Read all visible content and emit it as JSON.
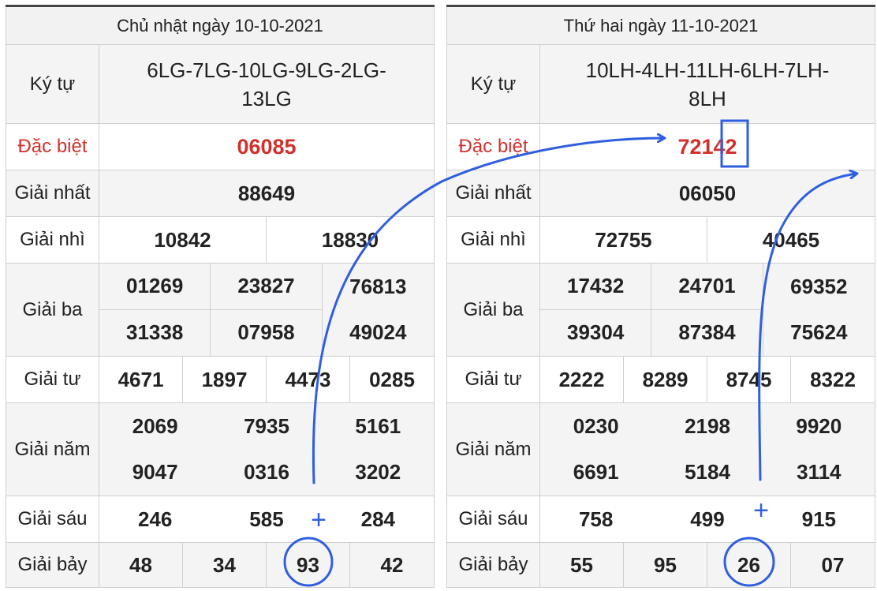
{
  "left": {
    "title": "Chủ nhật ngày 10-10-2021",
    "kytu_label": "Ký tự",
    "kytu_line1": "6LG-7LG-10LG-9LG-2LG-",
    "kytu_line2": "13LG",
    "db_label": "Đặc biệt",
    "db": "06085",
    "nhat_label": "Giải nhất",
    "nhat": "88649",
    "nhi_label": "Giải nhì",
    "nhi": [
      "10842",
      "18830"
    ],
    "ba_label": "Giải ba",
    "ba": [
      "01269",
      "23827",
      "76813",
      "31338",
      "07958",
      "49024"
    ],
    "tu_label": "Giải tư",
    "tu": [
      "4671",
      "1897",
      "4473",
      "0285"
    ],
    "nam_label": "Giải năm",
    "nam": [
      "2069",
      "7935",
      "5161",
      "9047",
      "0316",
      "3202"
    ],
    "sau_label": "Giải sáu",
    "sau": [
      "246",
      "585",
      "284"
    ],
    "bay_label": "Giải bảy",
    "bay": [
      "48",
      "34",
      "93",
      "42"
    ]
  },
  "right": {
    "title": "Thứ hai ngày 11-10-2021",
    "kytu_label": "Ký tự",
    "kytu_line1": "10LH-4LH-11LH-6LH-7LH-",
    "kytu_line2": "8LH",
    "db_label": "Đặc biệt",
    "db": "72142",
    "nhat_label": "Giải nhất",
    "nhat": "06050",
    "nhi_label": "Giải nhì",
    "nhi": [
      "72755",
      "40465"
    ],
    "ba_label": "Giải ba",
    "ba": [
      "17432",
      "24701",
      "69352",
      "39304",
      "87384",
      "75624"
    ],
    "tu_label": "Giải tư",
    "tu": [
      "2222",
      "8289",
      "8745",
      "8322"
    ],
    "nam_label": "Giải năm",
    "nam": [
      "0230",
      "2198",
      "9920",
      "6691",
      "5184",
      "3114"
    ],
    "sau_label": "Giải sáu",
    "sau": [
      "758",
      "499",
      "915"
    ],
    "bay_label": "Giải bảy",
    "bay": [
      "55",
      "95",
      "26",
      "07"
    ]
  },
  "annotations": {
    "plus_sign": "+",
    "color": "#2f5fe0"
  }
}
